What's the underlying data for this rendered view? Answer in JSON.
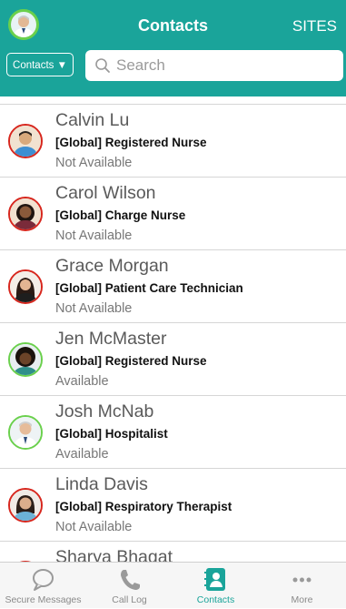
{
  "header": {
    "title": "Contacts",
    "sites_label": "SITES",
    "filter_label": "Contacts ▼",
    "search_placeholder": "Search"
  },
  "contacts": [
    {
      "name": "Calvin Lu",
      "role": "[Global] Registered Nurse",
      "status": "Not Available",
      "available": false
    },
    {
      "name": "Carol Wilson",
      "role": "[Global] Charge Nurse",
      "status": "Not Available",
      "available": false
    },
    {
      "name": "Grace Morgan",
      "role": "[Global] Patient Care Technician",
      "status": "Not Available",
      "available": false
    },
    {
      "name": "Jen McMaster",
      "role": "[Global] Registered Nurse",
      "status": "Available",
      "available": true
    },
    {
      "name": "Josh McNab",
      "role": "[Global] Hospitalist",
      "status": "Available",
      "available": true
    },
    {
      "name": "Linda Davis",
      "role": "[Global] Respiratory Therapist",
      "status": "Not Available",
      "available": false
    },
    {
      "name": "Sharya Bhagat",
      "role": "",
      "status": "",
      "available": false
    }
  ],
  "tabs": [
    {
      "label": "Secure Messages",
      "icon": "chat-bubble-icon"
    },
    {
      "label": "Call Log",
      "icon": "phone-icon"
    },
    {
      "label": "Contacts",
      "icon": "address-book-icon",
      "active": true
    },
    {
      "label": "More",
      "icon": "ellipsis-icon"
    }
  ],
  "colors": {
    "brand": "#1aa49a",
    "available": "#6ad04c",
    "not_available": "#d7261d"
  }
}
